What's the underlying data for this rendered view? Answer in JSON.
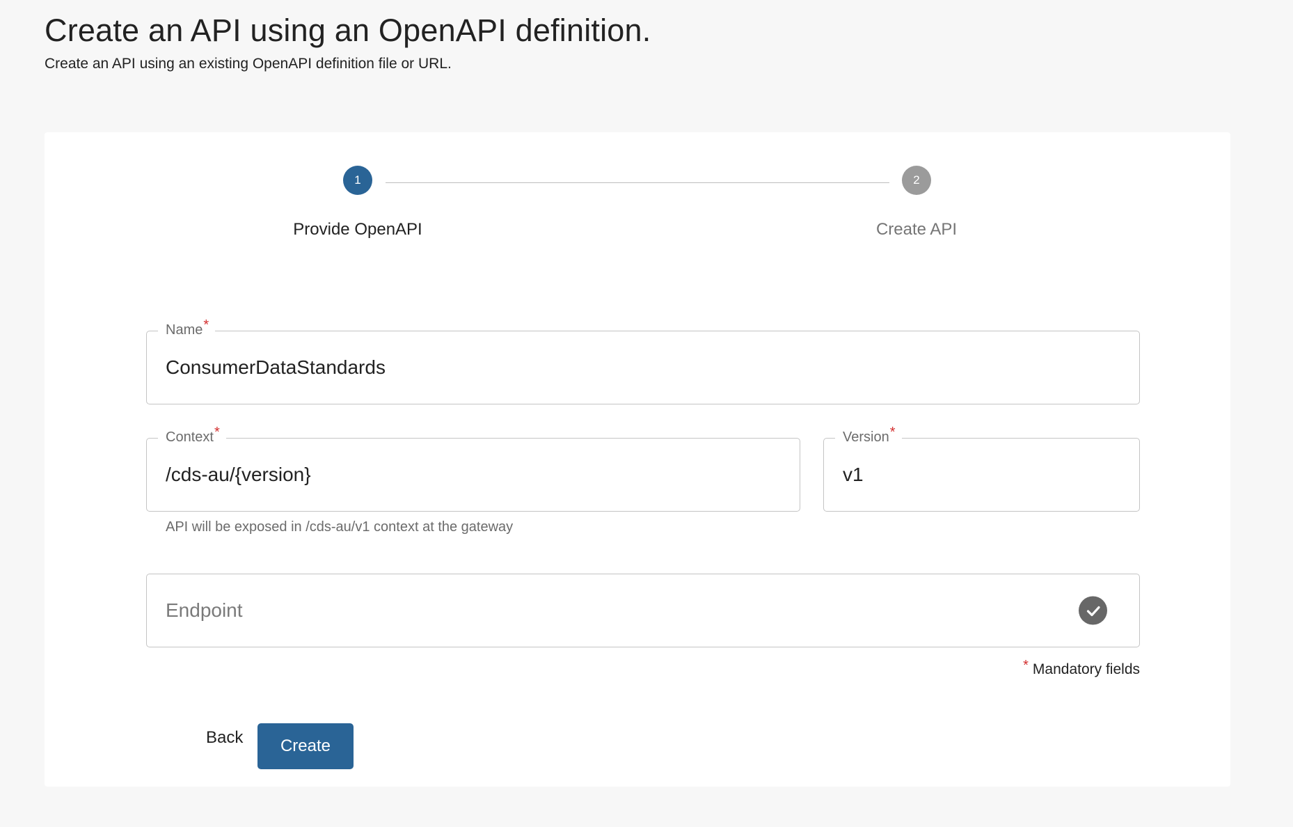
{
  "header": {
    "title": "Create an API using an OpenAPI definition.",
    "subtitle": "Create an API using an existing OpenAPI definition file or URL."
  },
  "stepper": {
    "active_step": 1,
    "steps": [
      {
        "number": "1",
        "label": "Provide OpenAPI",
        "state": "active"
      },
      {
        "number": "2",
        "label": "Create API",
        "state": "inactive"
      }
    ]
  },
  "form": {
    "name": {
      "label": "Name",
      "required_mark": "*",
      "value": "ConsumerDataStandards"
    },
    "context": {
      "label": "Context",
      "required_mark": "*",
      "value": "/cds-au/{version}",
      "helper": "API will be exposed in /cds-au/v1 context at the gateway"
    },
    "version": {
      "label": "Version",
      "required_mark": "*",
      "value": "v1"
    },
    "endpoint": {
      "placeholder": "Endpoint",
      "status_icon": "check-circle-icon"
    },
    "mandatory_note": {
      "mark": "*",
      "text": "Mandatory fields"
    }
  },
  "actions": {
    "back_label": "Back",
    "create_label": "Create"
  },
  "colors": {
    "primary": "#2a6496",
    "inactive_step": "#9b9b9b",
    "required": "#d32f2f",
    "page_background": "#f7f7f7"
  }
}
